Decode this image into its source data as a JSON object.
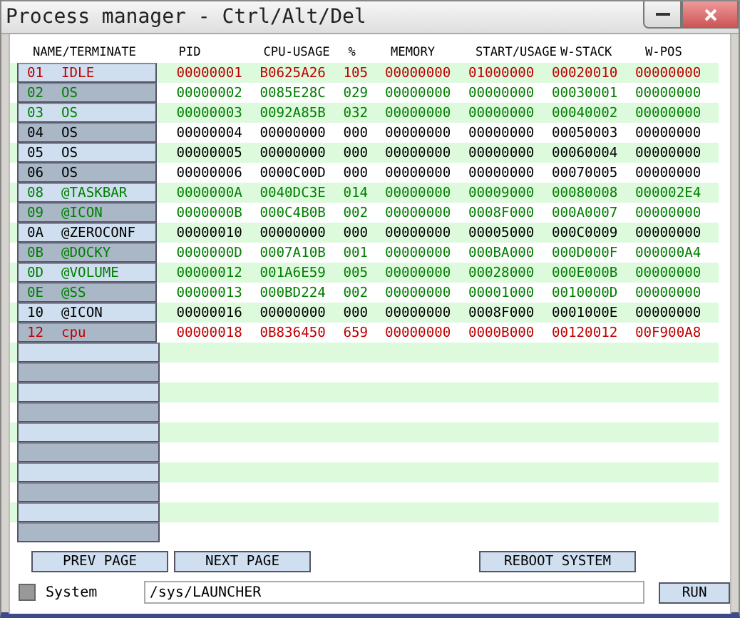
{
  "window": {
    "title": "Process manager - Ctrl/Alt/Del"
  },
  "table": {
    "name_column_header": "NAME/TERMINATE",
    "columns": [
      "PID",
      "CPU-USAGE",
      "%",
      "MEMORY",
      "START/USAGE",
      "W-STACK",
      "W-POS"
    ],
    "rows": [
      {
        "id": "01",
        "name": "IDLE",
        "kind": "critical",
        "cells": [
          "00000001",
          "B0625A26",
          "105",
          "00000000",
          "01000000",
          "00020010",
          "00000000"
        ]
      },
      {
        "id": "02",
        "name": "OS",
        "kind": "active",
        "cells": [
          "00000002",
          "0085E28C",
          "029",
          "00000000",
          "00000000",
          "00030001",
          "00000000"
        ]
      },
      {
        "id": "03",
        "name": "OS",
        "kind": "active",
        "cells": [
          "00000003",
          "0092A85B",
          "032",
          "00000000",
          "00000000",
          "00040002",
          "00000000"
        ]
      },
      {
        "id": "04",
        "name": "OS",
        "kind": "inactive",
        "cells": [
          "00000004",
          "00000000",
          "000",
          "00000000",
          "00000000",
          "00050003",
          "00000000"
        ]
      },
      {
        "id": "05",
        "name": "OS",
        "kind": "inactive",
        "cells": [
          "00000005",
          "00000000",
          "000",
          "00000000",
          "00000000",
          "00060004",
          "00000000"
        ]
      },
      {
        "id": "06",
        "name": "OS",
        "kind": "inactive",
        "cells": [
          "00000006",
          "0000C00D",
          "000",
          "00000000",
          "00000000",
          "00070005",
          "00000000"
        ]
      },
      {
        "id": "08",
        "name": "@TASKBAR",
        "kind": "active",
        "cells": [
          "0000000A",
          "0040DC3E",
          "014",
          "00000000",
          "00009000",
          "00080008",
          "000002E4"
        ]
      },
      {
        "id": "09",
        "name": "@ICON",
        "kind": "active",
        "cells": [
          "0000000B",
          "000C4B0B",
          "002",
          "00000000",
          "0008F000",
          "000A0007",
          "00000000"
        ]
      },
      {
        "id": "0A",
        "name": "@ZEROCONF",
        "kind": "inactive",
        "cells": [
          "00000010",
          "00000000",
          "000",
          "00000000",
          "00005000",
          "000C0009",
          "00000000"
        ]
      },
      {
        "id": "0B",
        "name": "@DOCKY",
        "kind": "active",
        "cells": [
          "0000000D",
          "0007A10B",
          "001",
          "00000000",
          "000BA000",
          "000D000F",
          "000000A4"
        ]
      },
      {
        "id": "0D",
        "name": "@VOLUME",
        "kind": "active",
        "cells": [
          "00000012",
          "001A6E59",
          "005",
          "00000000",
          "00028000",
          "000E000B",
          "00000000"
        ]
      },
      {
        "id": "0E",
        "name": "@SS",
        "kind": "active",
        "cells": [
          "00000013",
          "000BD224",
          "002",
          "00000000",
          "00001000",
          "0010000D",
          "00000000"
        ]
      },
      {
        "id": "10",
        "name": "@ICON",
        "kind": "inactive",
        "cells": [
          "00000016",
          "00000000",
          "000",
          "00000000",
          "0008F000",
          "0001000E",
          "00000000"
        ]
      },
      {
        "id": "12",
        "name": "cpu",
        "kind": "critical",
        "cells": [
          "00000018",
          "0B836450",
          "659",
          "00000000",
          "0000B000",
          "00120012",
          "00F900A8"
        ]
      }
    ]
  },
  "buttons": {
    "prev": "PREV PAGE",
    "next": "NEXT PAGE",
    "reboot": "REBOOT SYSTEM"
  },
  "system_checkbox": {
    "label": "System",
    "checked": false
  },
  "command_field": {
    "value": "/sys/LAUNCHER"
  },
  "run_button": "RUN"
}
